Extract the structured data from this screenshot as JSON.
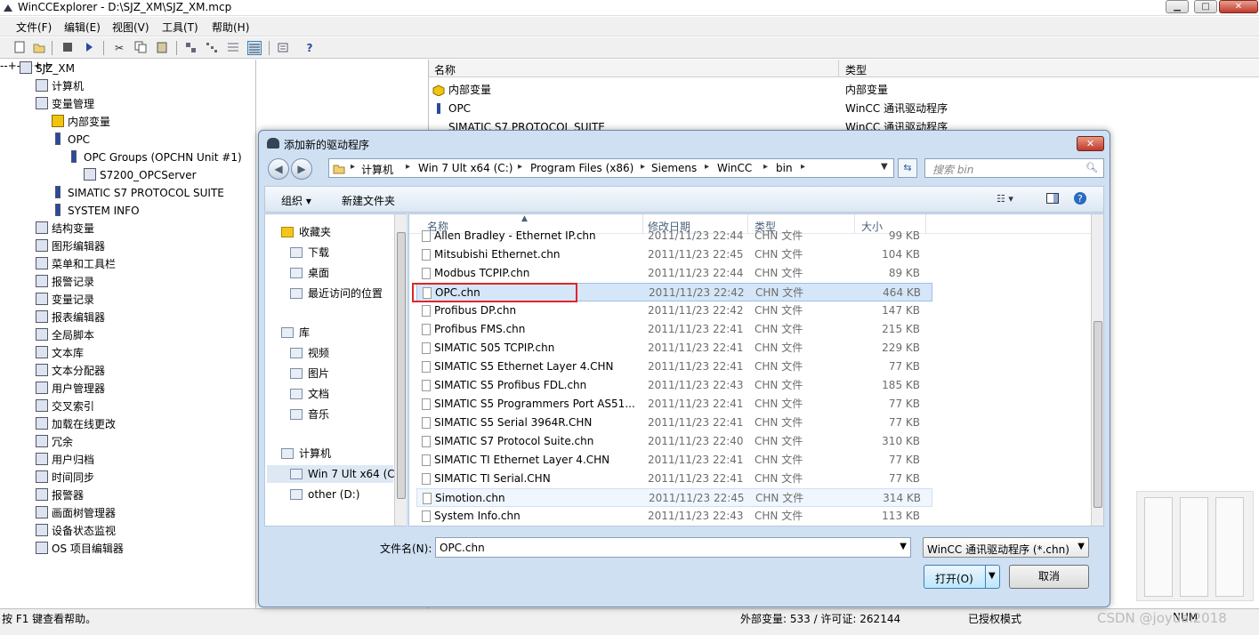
{
  "window": {
    "title": "WinCCExplorer - D:\\SJZ_XM\\SJZ_XM.mcp",
    "min": "▁",
    "max": "□",
    "close": "✕"
  },
  "menu": [
    "文件(F)",
    "编辑(E)",
    "视图(V)",
    "工具(T)",
    "帮助(H)"
  ],
  "toolbar_icons": [
    "new-icon",
    "open-icon",
    "stop-icon",
    "run-icon",
    "cut-icon",
    "copy-icon",
    "paste-icon",
    "large-icons-icon",
    "small-icons-icon",
    "list-icon",
    "details-icon",
    "properties-icon",
    "help-icon"
  ],
  "tree": [
    {
      "label": "SJZ_XM",
      "level": 0,
      "exp": "-",
      "icon": "project-icon"
    },
    {
      "label": "计算机",
      "level": 1,
      "icon": "computer-icon"
    },
    {
      "label": "变量管理",
      "level": 1,
      "exp": "-",
      "icon": "tag-management-icon"
    },
    {
      "label": "内部变量",
      "level": 2,
      "exp": "+",
      "icon": "internal-tags-icon"
    },
    {
      "label": "OPC",
      "level": 2,
      "exp": "-",
      "icon": "driver-icon"
    },
    {
      "label": "OPC Groups (OPCHN Unit #1)",
      "level": 3,
      "exp": "-",
      "icon": "driver-icon"
    },
    {
      "label": "S7200_OPCServer",
      "level": 4,
      "exp": "+",
      "icon": "connection-icon"
    },
    {
      "label": "SIMATIC S7 PROTOCOL SUITE",
      "level": 2,
      "exp": "+",
      "icon": "driver-icon"
    },
    {
      "label": "SYSTEM INFO",
      "level": 2,
      "exp": "+",
      "icon": "driver-icon"
    },
    {
      "label": "结构变量",
      "level": 1,
      "icon": "struct-icon"
    },
    {
      "label": "图形编辑器",
      "level": 1,
      "icon": "graphics-icon"
    },
    {
      "label": "菜单和工具栏",
      "level": 1,
      "icon": "menu-icon"
    },
    {
      "label": "报警记录",
      "level": 1,
      "icon": "alarm-icon"
    },
    {
      "label": "变量记录",
      "level": 1,
      "icon": "tag-log-icon"
    },
    {
      "label": "报表编辑器",
      "level": 1,
      "icon": "report-icon"
    },
    {
      "label": "全局脚本",
      "level": 1,
      "icon": "script-icon"
    },
    {
      "label": "文本库",
      "level": 1,
      "icon": "text-library-icon"
    },
    {
      "label": "文本分配器",
      "level": 1,
      "icon": "text-distributor-icon"
    },
    {
      "label": "用户管理器",
      "level": 1,
      "icon": "user-icon"
    },
    {
      "label": "交叉索引",
      "level": 1,
      "icon": "cross-ref-icon"
    },
    {
      "label": "加载在线更改",
      "level": 1,
      "icon": "online-change-icon"
    },
    {
      "label": "冗余",
      "level": 1,
      "icon": "redundancy-icon"
    },
    {
      "label": "用户归档",
      "level": 1,
      "icon": "archive-icon"
    },
    {
      "label": "时间同步",
      "level": 1,
      "icon": "clock-icon"
    },
    {
      "label": "报警器",
      "level": 1,
      "icon": "horn-icon"
    },
    {
      "label": "画面树管理器",
      "level": 1,
      "icon": "picture-tree-icon"
    },
    {
      "label": "设备状态监视",
      "level": 1,
      "icon": "device-monitor-icon"
    },
    {
      "label": "OS 项目编辑器",
      "level": 1,
      "icon": "os-editor-icon"
    }
  ],
  "right": {
    "col_name": "名称",
    "col_type": "类型",
    "rows": [
      {
        "name": "内部变量",
        "type": "内部变量"
      },
      {
        "name": "OPC",
        "type": "WinCC 通讯驱动程序"
      },
      {
        "name": "SIMATIC S7 PROTOCOL SUITE",
        "type": "WinCC 通讯驱动程序"
      }
    ]
  },
  "dialog": {
    "title": "添加新的驱动程序",
    "close": "✕",
    "breadcrumb": [
      "计算机",
      "Win 7 Ult x64 (C:)",
      "Program Files (x86)",
      "Siemens",
      "WinCC",
      "bin"
    ],
    "search_placeholder": "搜索 bin",
    "organize": "组织 ▾",
    "new_folder": "新建文件夹",
    "nav": [
      {
        "label": "收藏夹",
        "type": "head",
        "icon": "favorites-icon"
      },
      {
        "label": "下载",
        "type": "item",
        "icon": "downloads-icon"
      },
      {
        "label": "桌面",
        "type": "item",
        "icon": "desktop-icon"
      },
      {
        "label": "最近访问的位置",
        "type": "item",
        "icon": "recent-places-icon"
      },
      {
        "label": "库",
        "type": "head",
        "icon": "libraries-icon"
      },
      {
        "label": "视频",
        "type": "item",
        "icon": "videos-icon"
      },
      {
        "label": "图片",
        "type": "item",
        "icon": "pictures-icon"
      },
      {
        "label": "文档",
        "type": "item",
        "icon": "documents-icon"
      },
      {
        "label": "音乐",
        "type": "item",
        "icon": "music-icon"
      },
      {
        "label": "计算机",
        "type": "head",
        "icon": "computer-icon"
      },
      {
        "label": "Win 7 Ult x64 (C",
        "type": "sel",
        "icon": "drive-c-icon"
      },
      {
        "label": "other (D:)",
        "type": "item",
        "icon": "drive-d-icon"
      }
    ],
    "columns": {
      "name": "名称",
      "date": "修改日期",
      "type": "类型",
      "size": "大小"
    },
    "files": [
      {
        "name": "Allen Bradley - Ethernet IP.chn",
        "date": "2011/11/23 22:44",
        "type": "CHN 文件",
        "size": "99 KB"
      },
      {
        "name": "Mitsubishi Ethernet.chn",
        "date": "2011/11/23 22:45",
        "type": "CHN 文件",
        "size": "104 KB"
      },
      {
        "name": "Modbus TCPIP.chn",
        "date": "2011/11/23 22:44",
        "type": "CHN 文件",
        "size": "89 KB"
      },
      {
        "name": "OPC.chn",
        "date": "2011/11/23 22:42",
        "type": "CHN 文件",
        "size": "464 KB",
        "state": "sel"
      },
      {
        "name": "Profibus DP.chn",
        "date": "2011/11/23 22:42",
        "type": "CHN 文件",
        "size": "147 KB"
      },
      {
        "name": "Profibus FMS.chn",
        "date": "2011/11/23 22:41",
        "type": "CHN 文件",
        "size": "215 KB"
      },
      {
        "name": "SIMATIC 505 TCPIP.chn",
        "date": "2011/11/23 22:41",
        "type": "CHN 文件",
        "size": "229 KB"
      },
      {
        "name": "SIMATIC S5 Ethernet Layer 4.CHN",
        "date": "2011/11/23 22:41",
        "type": "CHN 文件",
        "size": "77 KB"
      },
      {
        "name": "SIMATIC S5 Profibus FDL.chn",
        "date": "2011/11/23 22:43",
        "type": "CHN 文件",
        "size": "185 KB"
      },
      {
        "name": "SIMATIC S5 Programmers Port AS51...",
        "date": "2011/11/23 22:41",
        "type": "CHN 文件",
        "size": "77 KB"
      },
      {
        "name": "SIMATIC S5 Serial 3964R.CHN",
        "date": "2011/11/23 22:41",
        "type": "CHN 文件",
        "size": "77 KB"
      },
      {
        "name": "SIMATIC S7 Protocol Suite.chn",
        "date": "2011/11/23 22:40",
        "type": "CHN 文件",
        "size": "310 KB"
      },
      {
        "name": "SIMATIC TI Ethernet Layer 4.CHN",
        "date": "2011/11/23 22:41",
        "type": "CHN 文件",
        "size": "77 KB"
      },
      {
        "name": "SIMATIC TI Serial.CHN",
        "date": "2011/11/23 22:41",
        "type": "CHN 文件",
        "size": "77 KB"
      },
      {
        "name": "Simotion.chn",
        "date": "2011/11/23 22:45",
        "type": "CHN 文件",
        "size": "314 KB",
        "state": "hot"
      },
      {
        "name": "System Info.chn",
        "date": "2011/11/23 22:43",
        "type": "CHN 文件",
        "size": "113 KB"
      }
    ],
    "filename_label": "文件名(N):",
    "filename_value": "OPC.chn",
    "filetype_value": "WinCC 通讯驱动程序 (*.chn)",
    "open_label": "打开(O)",
    "cancel_label": "取消"
  },
  "status": {
    "help": "按 F1 键查看帮助。",
    "tags": "外部变量: 533 / 许可证: 262144",
    "license": "已授权模式",
    "num": "NUM"
  },
  "watermark": "CSDN @joyuai2018",
  "colors": {
    "selection": "#d5e6f8",
    "highlight_box": "#e0242a",
    "dialog_frame": "#cfe0f3",
    "close_red": "#c0392b"
  }
}
